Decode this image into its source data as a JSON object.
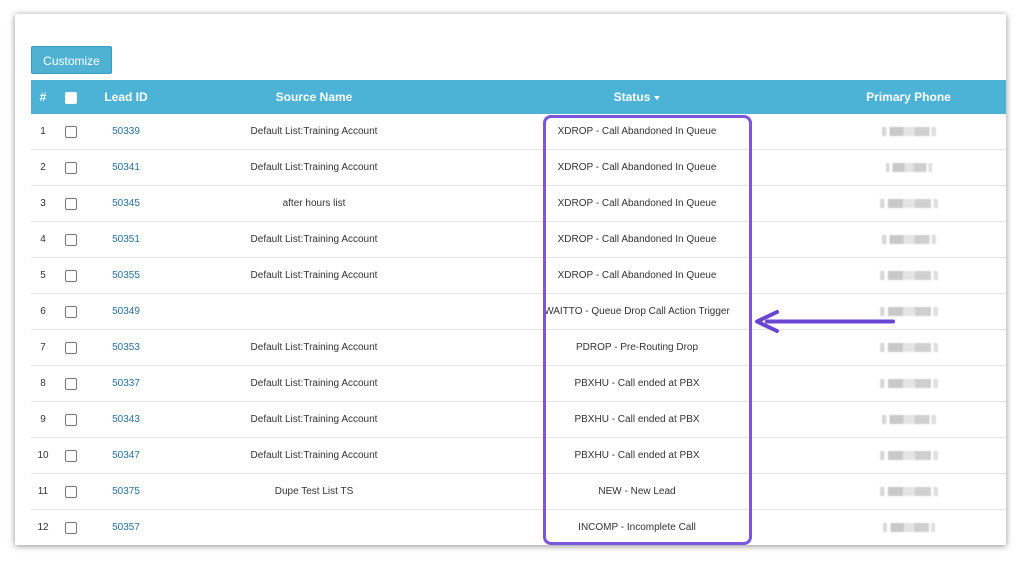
{
  "toolbar": {
    "customize_label": "Customize"
  },
  "table": {
    "headers": {
      "num": "#",
      "lead_id": "Lead ID",
      "source_name": "Source Name",
      "status": "Status",
      "primary_phone": "Primary Phone"
    },
    "rows": [
      {
        "num": "1",
        "lead_id": "50339",
        "source": "Default List:Training Account",
        "status": "XDROP - Call Abandoned In Queue"
      },
      {
        "num": "2",
        "lead_id": "50341",
        "source": "Default List:Training Account",
        "status": "XDROP - Call Abandoned In Queue"
      },
      {
        "num": "3",
        "lead_id": "50345",
        "source": "after hours list",
        "status": "XDROP - Call Abandoned In Queue"
      },
      {
        "num": "4",
        "lead_id": "50351",
        "source": "Default List:Training Account",
        "status": "XDROP - Call Abandoned In Queue"
      },
      {
        "num": "5",
        "lead_id": "50355",
        "source": "Default List:Training Account",
        "status": "XDROP - Call Abandoned In Queue"
      },
      {
        "num": "6",
        "lead_id": "50349",
        "source": "",
        "status": "WAITTO - Queue Drop Call Action Trigger"
      },
      {
        "num": "7",
        "lead_id": "50353",
        "source": "Default List:Training Account",
        "status": "PDROP - Pre-Routing Drop"
      },
      {
        "num": "8",
        "lead_id": "50337",
        "source": "Default List:Training Account",
        "status": "PBXHU - Call ended at PBX"
      },
      {
        "num": "9",
        "lead_id": "50343",
        "source": "Default List:Training Account",
        "status": "PBXHU - Call ended at PBX"
      },
      {
        "num": "10",
        "lead_id": "50347",
        "source": "Default List:Training Account",
        "status": "PBXHU - Call ended at PBX"
      },
      {
        "num": "11",
        "lead_id": "50375",
        "source": "Dupe Test List TS",
        "status": "NEW - New Lead"
      },
      {
        "num": "12",
        "lead_id": "50357",
        "source": "",
        "status": "INCOMP - Incomplete Call"
      }
    ]
  },
  "colors": {
    "header_bg": "#4db3d6",
    "button_bg": "#4fb2d3",
    "link": "#2a6f9e",
    "highlight": "#7b55dc"
  },
  "icons": {
    "sort": "sort-caret-down-icon",
    "arrow": "pointing-arrow-icon"
  }
}
